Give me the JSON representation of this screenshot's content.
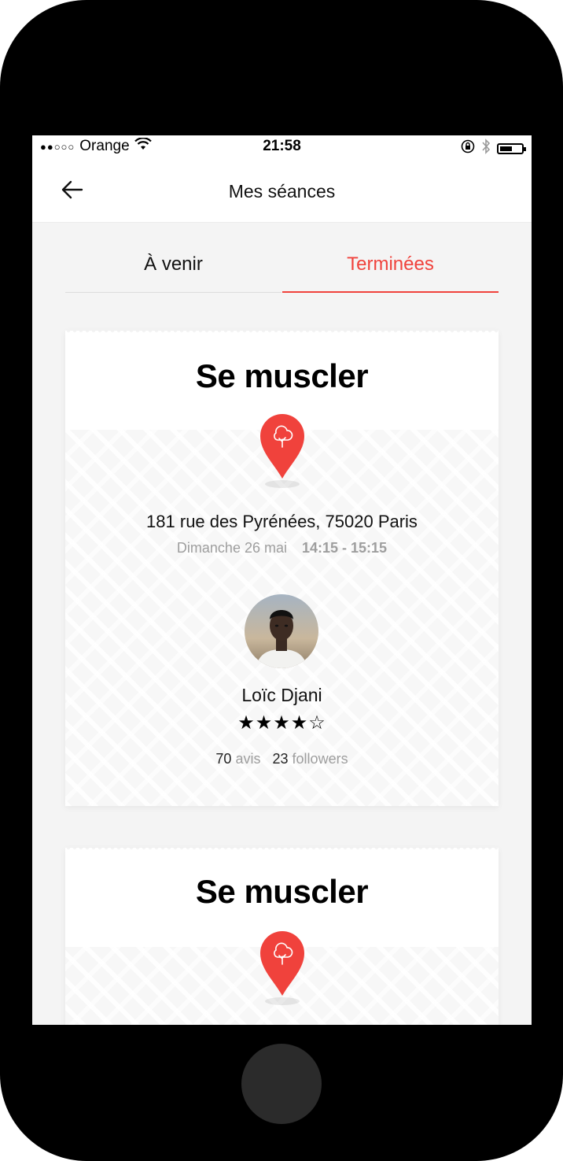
{
  "status_bar": {
    "signal": "●●○○○",
    "carrier": "Orange",
    "time": "21:58",
    "icons": [
      "wifi-icon",
      "rotation-lock-icon",
      "bluetooth-icon",
      "battery-icon"
    ]
  },
  "header": {
    "title": "Mes séances",
    "back_icon": "arrow-left-icon"
  },
  "tabs": [
    {
      "label": "À venir",
      "active": false
    },
    {
      "label": "Terminées",
      "active": true
    }
  ],
  "accent_color": "#f0423c",
  "sessions": [
    {
      "title": "Se muscler",
      "pin_icon": "tree-pin-icon",
      "address": "181 rue des Pyrénées, 75020 Paris",
      "date": "Dimanche 26 mai",
      "time": "14:15 - 15:15",
      "coach": {
        "name": "Loïc Djani",
        "rating_out_of_5": 4,
        "stars": "★★★★☆",
        "reviews_count": "70",
        "reviews_label": "avis",
        "followers_count": "23",
        "followers_label": "followers"
      }
    },
    {
      "title": "Se muscler",
      "pin_icon": "tree-pin-icon"
    }
  ]
}
